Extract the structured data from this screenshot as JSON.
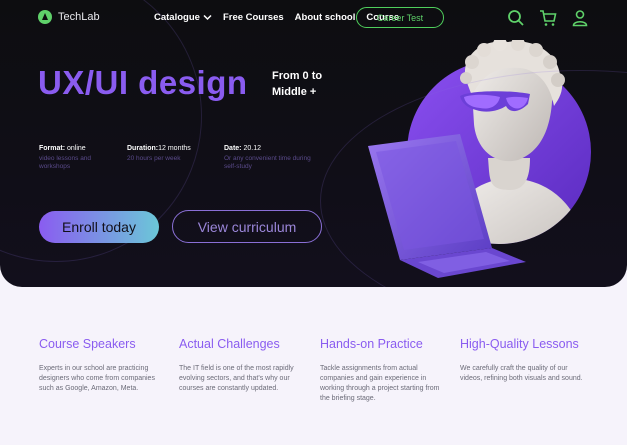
{
  "brand": {
    "name": "TechLab"
  },
  "nav": {
    "items": [
      "Catalogue",
      "Free Courses",
      "About school",
      "Course"
    ],
    "cta": "Career Test"
  },
  "header_icons": [
    "search-icon",
    "cart-icon",
    "user-icon"
  ],
  "hero": {
    "title": "UX/UI design",
    "level_line1": "From 0 to",
    "level_line2": "Middle +",
    "info": [
      {
        "label": "Format:",
        "value": "online",
        "sub": "video lessons and workshops"
      },
      {
        "label": "Duration:",
        "value": "12 months",
        "sub": "20 hours per week"
      },
      {
        "label": "Date:",
        "value": "20.12",
        "sub": "Or any convenient time during self-study"
      }
    ],
    "enroll_label": "Enroll today",
    "curriculum_label": "View curriculum"
  },
  "features": [
    {
      "title": "Course Speakers",
      "text": "Experts in our school are practicing designers who come from companies such as Google, Amazon, Meta."
    },
    {
      "title": "Actual Challenges",
      "text": "The IT field is one of the most rapidly evolving sectors, and that's why our courses are constantly updated."
    },
    {
      "title": "Hands-on Practice",
      "text": "Tackle assignments from actual companies and gain experience in working through a project starting from the briefing stage."
    },
    {
      "title": "High-Quality Lessons",
      "text": "We carefully craft the quality of our videos, refining both visuals and sound."
    }
  ],
  "colors": {
    "accent": "#8a5cf0",
    "green": "#5fd16a",
    "hero_bg": "#0d0d10",
    "page_bg": "#f6f3fb"
  }
}
